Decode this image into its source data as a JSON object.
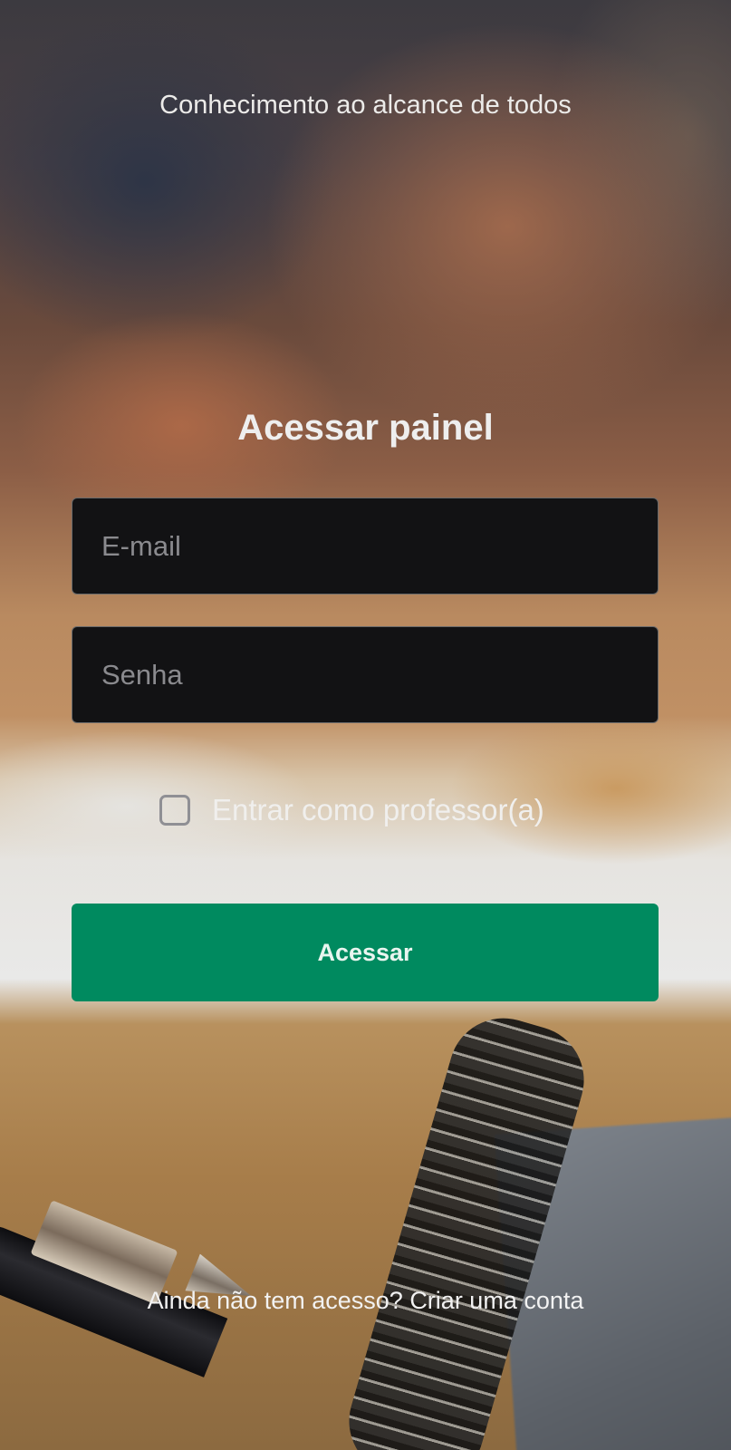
{
  "header": {
    "tagline": "Conhecimento ao alcance de todos"
  },
  "login": {
    "title": "Acessar painel",
    "email_placeholder": "E-mail",
    "email_value": "",
    "password_placeholder": "Senha",
    "password_value": "",
    "teacher_checkbox_label": "Entrar como professor(a)",
    "teacher_checkbox_checked": false,
    "submit_label": "Acessar"
  },
  "footer": {
    "signup_prompt": "Ainda não tem acesso?",
    "signup_link": "Criar uma conta"
  },
  "colors": {
    "accent": "#008a5f",
    "input_background": "#121214",
    "text": "#eeeeee"
  },
  "icons": {
    "checkbox": "checkbox-unchecked-icon"
  }
}
